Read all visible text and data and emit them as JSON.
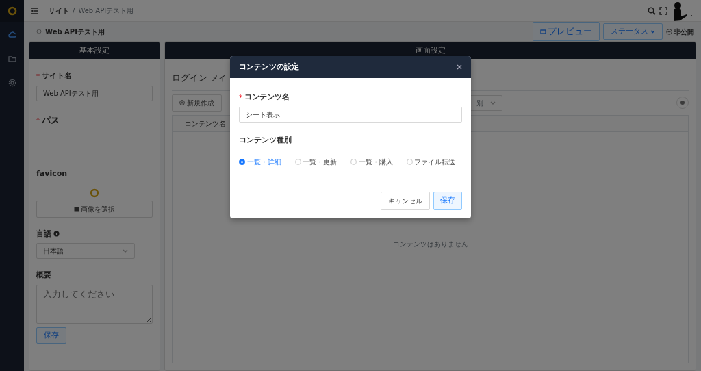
{
  "breadcrumb": {
    "separator": "/",
    "items": [
      {
        "label": "サイト",
        "current": false
      },
      {
        "label": "Web APIテスト用",
        "current": true
      }
    ]
  },
  "page": {
    "title": "Web APIテスト用",
    "preview_button": "プレビュー",
    "status_button": "ステータス",
    "visibility": "非公開"
  },
  "basic_settings": {
    "title": "基本設定",
    "site_name_mark": "*",
    "site_name_label": "サイト名",
    "site_name_value": "Web APIテスト用",
    "path_mark": "*",
    "path_label": "パス",
    "favicon_label": "favicon",
    "select_image_button": "画像を選択",
    "language_label": "言語",
    "language_value": "日本語",
    "summary_label": "概要",
    "summary_placeholder": "入力してください",
    "save_button": "保存"
  },
  "screen_settings": {
    "title": "画面設定",
    "tabs": [
      {
        "label": "ログイン",
        "selected": false
      },
      {
        "label": "メイ",
        "selected": false
      }
    ],
    "new_button": "新規作成",
    "filter_value": "別",
    "table": {
      "columns": [
        "コンテンツ名"
      ]
    },
    "empty_text": "コンテンツはありません"
  },
  "dialog": {
    "title": "コンテンツの設定",
    "name_mark": "*",
    "name_label": "コンテンツ名",
    "name_value": "シート表示",
    "type_label": "コンテンツ種別",
    "types": [
      {
        "label": "一覧・詳細",
        "selected": true
      },
      {
        "label": "一覧・更新",
        "selected": false
      },
      {
        "label": "一覧・購入",
        "selected": false
      },
      {
        "label": "ファイル転送",
        "selected": false
      }
    ],
    "cancel_button": "キャンセル",
    "save_button": "保存"
  }
}
